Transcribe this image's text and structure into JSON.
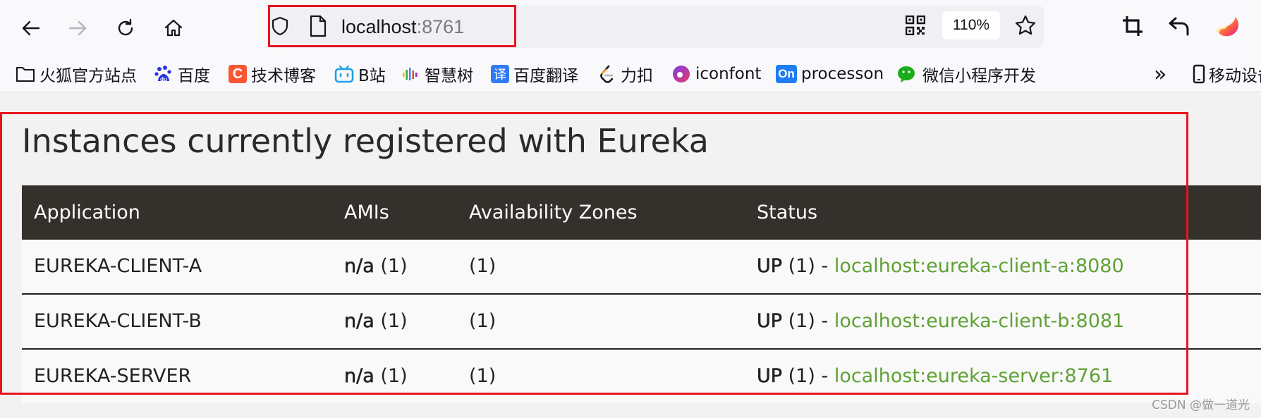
{
  "browser": {
    "url_host": "localhost",
    "url_port": ":8761",
    "zoom": "110%",
    "icons": {
      "back": "arrow-left-icon",
      "forward": "arrow-right-icon",
      "reload": "reload-icon",
      "home": "home-icon",
      "shield": "shield-icon",
      "page": "page-icon",
      "qr": "qr-code-icon",
      "star": "star-icon",
      "crop": "crop-icon",
      "undo": "undo-icon",
      "firefox": "firefox-icon"
    }
  },
  "bookmarks": [
    {
      "label": "火狐官方站点",
      "icon": "folder-icon"
    },
    {
      "label": "百度",
      "icon": "baidu-icon"
    },
    {
      "label": "技术博客",
      "icon": "csdn-icon",
      "color": "#fc5531",
      "glyph": "C"
    },
    {
      "label": "B站",
      "icon": "bilibili-icon",
      "color": "#1fa0e8"
    },
    {
      "label": "智慧树",
      "icon": "zhihuishu-icon"
    },
    {
      "label": "百度翻译",
      "icon": "translate-icon",
      "color": "#2f7bf5",
      "glyph": "译"
    },
    {
      "label": "力扣",
      "icon": "leetcode-icon"
    },
    {
      "label": "iconfont",
      "icon": "iconfont-icon"
    },
    {
      "label": "processon",
      "icon": "processon-icon",
      "color": "#1e7df2",
      "glyph": "On"
    },
    {
      "label": "微信小程序开发",
      "icon": "wechat-icon",
      "color": "#1aad19"
    }
  ],
  "bookmarks_more": "»",
  "bookmarks_mobile": "移动设备",
  "page": {
    "title": "Instances currently registered with Eureka",
    "columns": [
      "Application",
      "AMIs",
      "Availability Zones",
      "Status"
    ],
    "rows": [
      {
        "app": "EUREKA-CLIENT-A",
        "ami": "n/a",
        "ami_count": "(1)",
        "zones": "(1)",
        "status": "UP",
        "status_count": "(1) -",
        "link": "localhost:eureka-client-a:8080"
      },
      {
        "app": "EUREKA-CLIENT-B",
        "ami": "n/a",
        "ami_count": "(1)",
        "zones": "(1)",
        "status": "UP",
        "status_count": "(1) -",
        "link": "localhost:eureka-client-b:8081"
      },
      {
        "app": "EUREKA-SERVER",
        "ami": "n/a",
        "ami_count": "(1)",
        "zones": "(1)",
        "status": "UP",
        "status_count": "(1) -",
        "link": "localhost:eureka-server:8761"
      }
    ]
  },
  "watermark": "CSDN @做一道光",
  "colors": {
    "highlight": "#e8141e",
    "table_header": "#34302b",
    "link": "#5fa134"
  }
}
